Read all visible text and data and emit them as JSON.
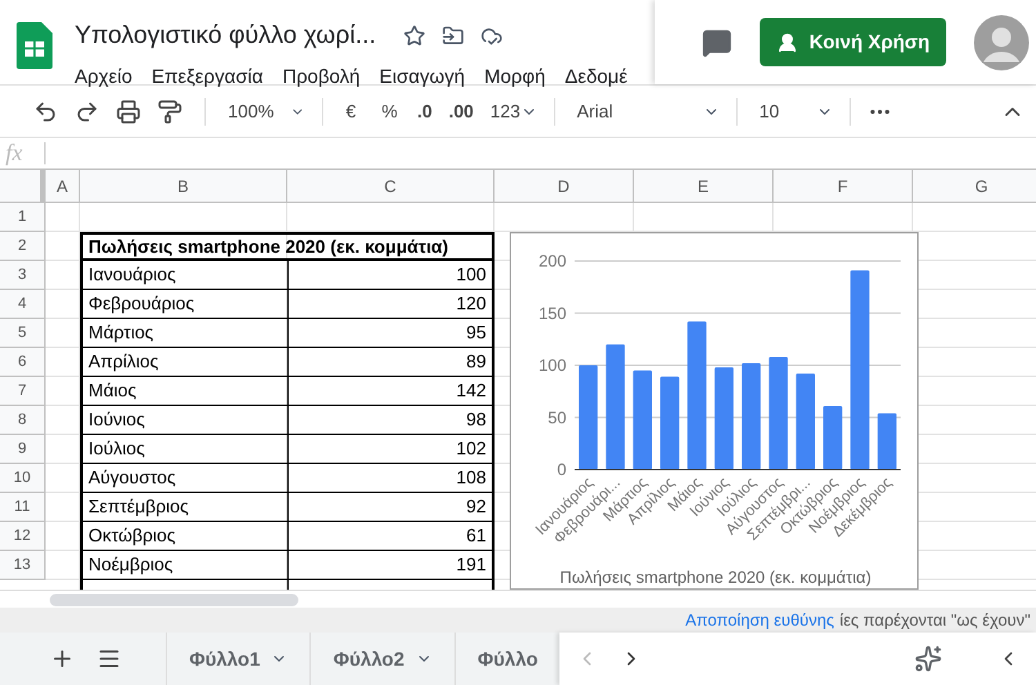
{
  "title": "Υπολογιστικό φύλλο χωρί...",
  "menu": [
    "Αρχείο",
    "Επεξεργασία",
    "Προβολή",
    "Εισαγωγή",
    "Μορφή",
    "Δεδομέ"
  ],
  "share_button": "Κοινή Χρήση",
  "toolbar": {
    "zoom": "100%",
    "currency": "€",
    "percent": "%",
    "decrease_decimals": ".0",
    "increase_decimals": ".00",
    "number_format": "123",
    "font": "Arial",
    "font_size": "10"
  },
  "formula_bar": {
    "label": "fx"
  },
  "columns": [
    "A",
    "B",
    "C",
    "D",
    "E",
    "F",
    "G"
  ],
  "rows": [
    {
      "number": "1",
      "cells": [
        "",
        ""
      ]
    },
    {
      "number": "2",
      "header": "Πωλήσεις smartphone 2020 (εκ. κομμάτια)"
    },
    {
      "number": "3",
      "cells": [
        "Ιανουάριος",
        "100"
      ]
    },
    {
      "number": "4",
      "cells": [
        "Φεβρουάριος",
        "120"
      ]
    },
    {
      "number": "5",
      "cells": [
        "Μάρτιος",
        "95"
      ]
    },
    {
      "number": "6",
      "cells": [
        "Απρίλιος",
        "89"
      ]
    },
    {
      "number": "7",
      "cells": [
        "Μάιος",
        "142"
      ]
    },
    {
      "number": "8",
      "cells": [
        "Ιούνιος",
        "98"
      ]
    },
    {
      "number": "9",
      "cells": [
        "Ιούλιος",
        "102"
      ]
    },
    {
      "number": "10",
      "cells": [
        "Αύγουστος",
        "108"
      ]
    },
    {
      "number": "11",
      "cells": [
        "Σεπτέμβριος",
        "92"
      ]
    },
    {
      "number": "12",
      "cells": [
        "Οκτώβριος",
        "61"
      ]
    },
    {
      "number": "13",
      "cells": [
        "Νοέμβριος",
        "191"
      ]
    }
  ],
  "chart": {
    "chart_data": {
      "type": "bar",
      "title": "Πωλήσεις smartphone 2020 (εκ. κομμάτια)",
      "categories": [
        "Ιανουάριος",
        "Φεβρουάρι...",
        "Μάρτιος",
        "Απρίλιος",
        "Μάιος",
        "Ιούνιος",
        "Ιούλιος",
        "Αύγουστος",
        "Σεπτέμβρι...",
        "Οκτώβριος",
        "Νοέμβριος",
        "Δεκέμβριος"
      ],
      "grid": true,
      "series": [
        {
          "color": "#4285f4",
          "values": [
            100,
            120,
            95,
            89,
            142,
            98,
            102,
            108,
            92,
            61,
            191,
            54
          ]
        }
      ],
      "ylim": [
        0,
        200
      ],
      "yticks": [
        0,
        50,
        100,
        150,
        200
      ]
    }
  },
  "notice": {
    "text": "ίες παρέχονται \"ως έχουν\"",
    "link": "Αποποίηση ευθύνης"
  },
  "sheet_tabs": [
    "Φύλλο1",
    "Φύλλο2",
    "Φύλλο"
  ]
}
